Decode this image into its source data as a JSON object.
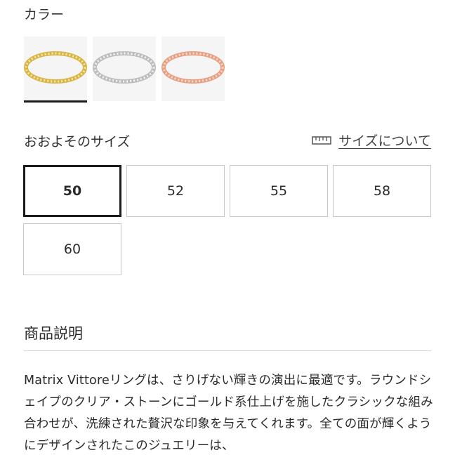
{
  "color_section": {
    "label": "カラー",
    "swatches": [
      {
        "name": "gold",
        "selected": true,
        "band_color": "#e2c15a",
        "stone_color": "#f3e6b0"
      },
      {
        "name": "silver",
        "selected": false,
        "band_color": "#c9c9c9",
        "stone_color": "#eeeeee"
      },
      {
        "name": "rose-gold",
        "selected": false,
        "band_color": "#e9a98f",
        "stone_color": "#f6d8cc"
      }
    ]
  },
  "size_section": {
    "label": "おおよそのサイズ",
    "guide_link": "サイズについて",
    "guide_icon": "ruler-icon",
    "selected": "50",
    "options": [
      "50",
      "52",
      "55",
      "58",
      "60"
    ]
  },
  "description": {
    "title": "商品説明",
    "text": "Matrix Vittoreリングは、さりげない輝きの演出に最適です。ラウンドシェイプのクリア・ストーンにゴールド系仕上げを施したクラシックな組み合わせが、洗練された贅沢な印象を与えてくれます。全ての面が輝くようにデザインされたこのジュエリーは、"
  },
  "colors": {
    "selected_border": "#1a1a1a",
    "option_border": "#c8c8c8",
    "text": "#2b2b2b"
  }
}
